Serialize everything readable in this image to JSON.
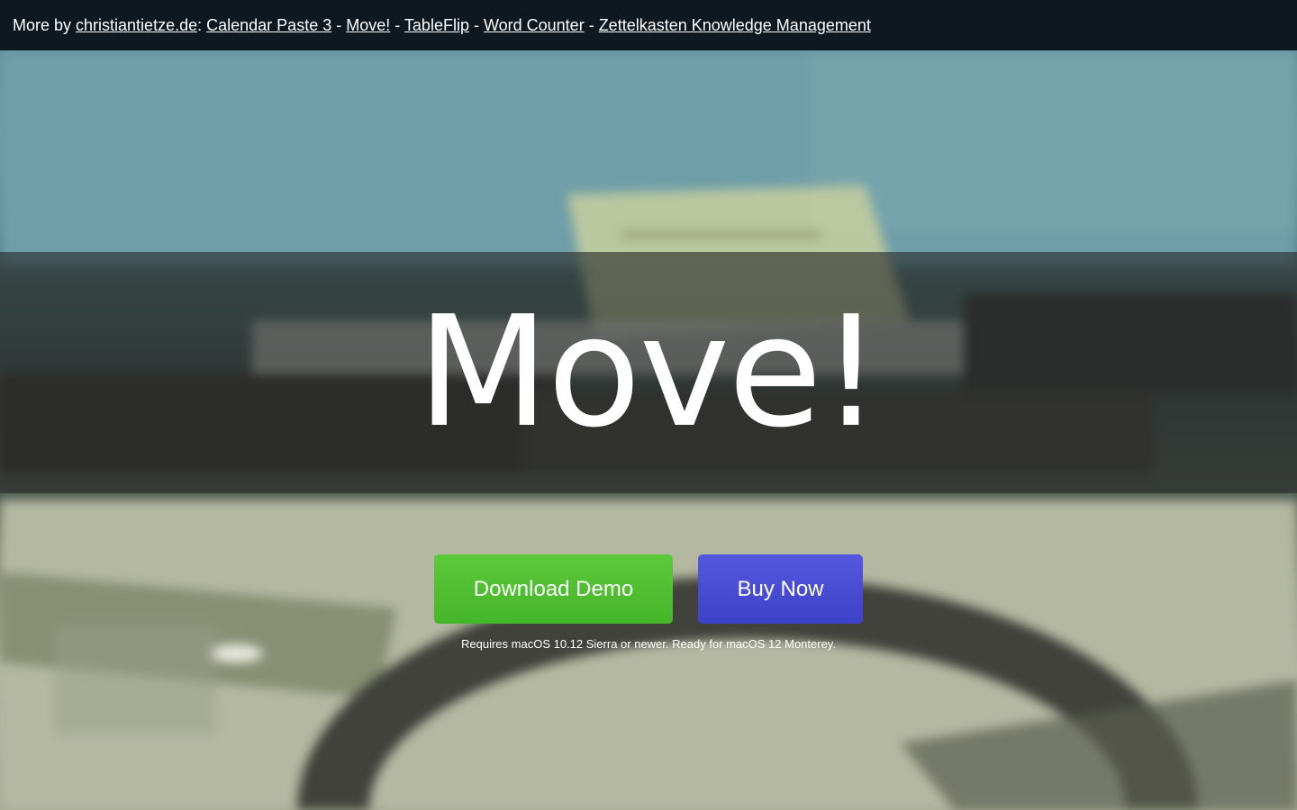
{
  "topbar": {
    "prefix": "More by ",
    "site_link": "christiantietze.de",
    "colon": ": ",
    "sep": " - ",
    "links": [
      "Calendar Paste 3",
      "Move!",
      "TableFlip",
      "Word Counter",
      "Zettelkasten Knowledge Management"
    ]
  },
  "hero": {
    "title": "Move!",
    "download_label": "Download Demo",
    "buy_label": "Buy Now",
    "requirements": "Requires macOS 10.12 Sierra or newer. Ready for macOS 12 Monterey."
  },
  "colors": {
    "topbar_bg": "#0e1820",
    "download_green": "#4fbf30",
    "buy_blue": "#474cd4"
  }
}
